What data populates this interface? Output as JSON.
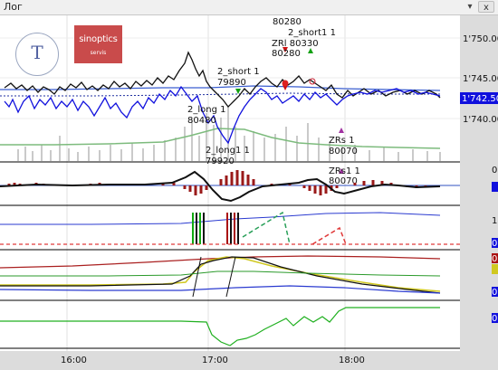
{
  "window": {
    "title": "Лог",
    "hide_glyph": "▾",
    "close_glyph": "x"
  },
  "logos": {
    "brand_text": "sinoptics",
    "brand_sub": "servis",
    "seal_glyph": "Т"
  },
  "price_axis": {
    "labels": [
      "1'750.00",
      "1'745.00",
      "1'740.00"
    ],
    "current_price": "1'742.50"
  },
  "indicator_axis": {
    "labels": [
      "0",
      "1",
      "0",
      "0",
      "0",
      "0"
    ]
  },
  "time_axis": {
    "labels": [
      "16:00",
      "17:00",
      "18:00"
    ]
  },
  "annotations": [
    {
      "text": "80280"
    },
    {
      "text": "2_short1 1"
    },
    {
      "text": "ZRl 80330"
    },
    {
      "text": "80280"
    },
    {
      "text": "2_short 1"
    },
    {
      "text": "79890"
    },
    {
      "text": "2_long 1"
    },
    {
      "text": "80480"
    },
    {
      "text": "2_long1 1"
    },
    {
      "text": "79920"
    },
    {
      "text": "ZRs 1"
    },
    {
      "text": "80070"
    },
    {
      "text": "ZRs1 1"
    },
    {
      "text": "80070"
    }
  ],
  "colors": {
    "price_blue": "#1010dd",
    "accent_red": "#c94b4b",
    "panel_border": "#000000",
    "axis_bg": "#dcdcdc"
  }
}
